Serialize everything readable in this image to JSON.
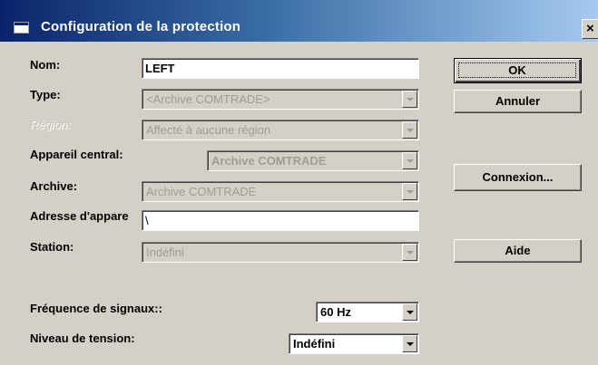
{
  "dialog": {
    "title": "Configuration de la protection",
    "close_glyph": "×"
  },
  "form": {
    "nom_label": "Nom:",
    "nom_value": "LEFT",
    "type_label": "Type:",
    "type_value": "<Archive COMTRADE>",
    "region_label": "Région:",
    "region_value": "Affecté à aucune région",
    "appareil_label": "Appareil central:",
    "appareil_value": "Archive COMTRADE",
    "archive_label": "Archive:",
    "archive_value": "Archive COMTRADE",
    "adresse_label": "Adresse d'appare",
    "adresse_value": "\\",
    "station_label": "Station:",
    "station_value": "Indéfini",
    "frequence_label": "Fréquence de signaux::",
    "frequence_value": "60 Hz",
    "tension_label": "Niveau de tension:",
    "tension_value": "Indéfini"
  },
  "buttons": {
    "ok": "OK",
    "annuler": "Annuler",
    "connexion": "Connexion...",
    "aide": "Aide"
  }
}
